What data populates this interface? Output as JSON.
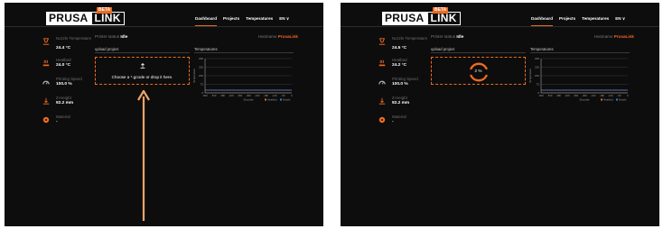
{
  "panels": [
    {
      "brand": {
        "name": "PRUSA",
        "product": "LINK",
        "badge": "BETA"
      },
      "nav": [
        {
          "label": "Dashboard",
          "active": true
        },
        {
          "label": "Projects",
          "active": false
        },
        {
          "label": "Temperatures",
          "active": false
        },
        {
          "label": "EN ∨",
          "active": false
        }
      ],
      "sidebar": [
        {
          "icon": "nozzle-icon",
          "label": "Nozzle Temperature",
          "value": "24.4 °C"
        },
        {
          "icon": "heatbed-icon",
          "label": "Heatbed",
          "value": "24.0 °C"
        },
        {
          "icon": "speedometer-icon",
          "label": "Printing Speed",
          "value": "100.0 %"
        },
        {
          "icon": "z-height-icon",
          "label": "Z-Height",
          "value": "92.2 mm"
        },
        {
          "icon": "material-icon",
          "label": "Material",
          "value": "-"
        }
      ],
      "status": {
        "label": "Printer status",
        "value": "Idle"
      },
      "hostname": {
        "label": "Hostname",
        "value": "PrusaLink"
      },
      "upload": {
        "title": "upload project",
        "text": "Choose a *.gcode or drop it here."
      },
      "temperatures": {
        "title": "Temperatures"
      }
    },
    {
      "brand": {
        "name": "PRUSA",
        "product": "LINK",
        "badge": "BETA"
      },
      "nav": [
        {
          "label": "Dashboard",
          "active": true
        },
        {
          "label": "Projects",
          "active": false
        },
        {
          "label": "Temperatures",
          "active": false
        },
        {
          "label": "EN ∨",
          "active": false
        }
      ],
      "sidebar": [
        {
          "icon": "nozzle-icon",
          "label": "Nozzle Temperature",
          "value": "24.5 °C"
        },
        {
          "icon": "heatbed-icon",
          "label": "Heatbed",
          "value": "24.2 °C"
        },
        {
          "icon": "speedometer-icon",
          "label": "Printing Speed",
          "value": "100.0 %"
        },
        {
          "icon": "z-height-icon",
          "label": "Z-Height",
          "value": "92.2 mm"
        },
        {
          "icon": "material-icon",
          "label": "Material",
          "value": "-"
        }
      ],
      "status": {
        "label": "Printer status",
        "value": "Idle"
      },
      "hostname": {
        "label": "Hostname",
        "value": "PrusaLink"
      },
      "upload": {
        "title": "upload project",
        "progress": "2 %"
      },
      "temperatures": {
        "title": "Temperatures"
      }
    }
  ],
  "chart_data": [
    {
      "type": "line",
      "title": "Temperatures",
      "xlabel": "Seconds",
      "ylabel": "Temperature",
      "y_ticks": [
        "300",
        "225",
        "150",
        "75",
        "0"
      ],
      "x_ticks": [
        "-600",
        "-540",
        "-480",
        "-420",
        "-360",
        "-300",
        "-240",
        "-180",
        "-120",
        "-60",
        "0"
      ],
      "ylim": [
        0,
        300
      ],
      "xlim": [
        -600,
        0
      ],
      "grid": true,
      "legend": {
        "position": "bottom-right",
        "entries": [
          "Heatbed",
          "Nozzle"
        ]
      },
      "series": [
        {
          "name": "Heatbed",
          "color": "#ed6b21",
          "x": [
            -600,
            0
          ],
          "y": [
            24.0,
            24.0
          ]
        },
        {
          "name": "Nozzle",
          "color": "#3d7bd9",
          "x": [
            -600,
            0
          ],
          "y": [
            24.4,
            24.4
          ]
        }
      ]
    },
    {
      "type": "line",
      "title": "Temperatures",
      "xlabel": "Seconds",
      "ylabel": "Temperature",
      "y_ticks": [
        "300",
        "225",
        "150",
        "75",
        "0"
      ],
      "x_ticks": [
        "-600",
        "-540",
        "-480",
        "-420",
        "-360",
        "-300",
        "-240",
        "-180",
        "-120",
        "-60",
        "0"
      ],
      "ylim": [
        0,
        300
      ],
      "xlim": [
        -600,
        0
      ],
      "grid": true,
      "legend": {
        "position": "bottom-right",
        "entries": [
          "Heatbed",
          "Nozzle"
        ]
      },
      "series": [
        {
          "name": "Heatbed",
          "color": "#ed6b21",
          "x": [
            -600,
            -60,
            0
          ],
          "y": [
            24.0,
            24.0,
            24.2
          ]
        },
        {
          "name": "Nozzle",
          "color": "#3d7bd9",
          "x": [
            -600,
            -60,
            0
          ],
          "y": [
            24.4,
            24.4,
            24.5
          ]
        }
      ]
    }
  ],
  "annotation": {
    "color": "#f0a469"
  }
}
